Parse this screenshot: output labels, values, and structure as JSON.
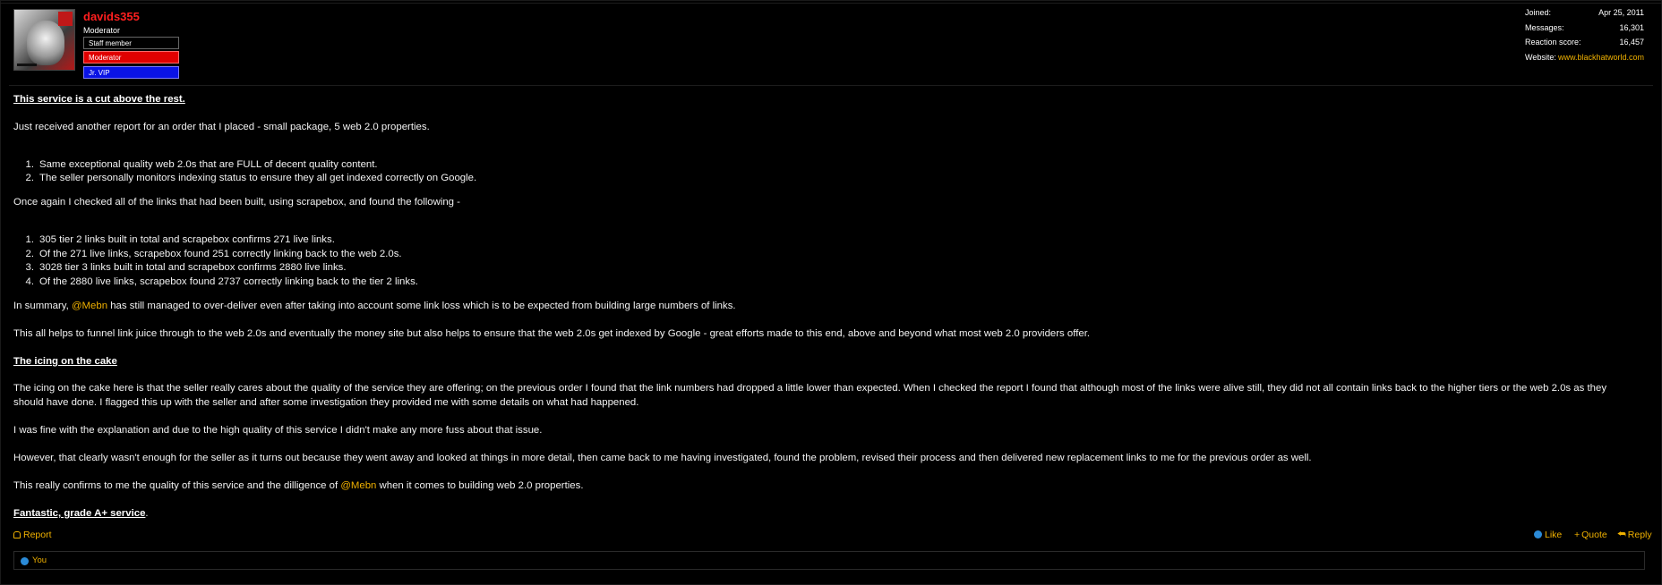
{
  "user": {
    "name": "davids355",
    "title": "Moderator",
    "banners": [
      "Staff member",
      "Moderator",
      "Jr. VIP"
    ]
  },
  "stats": [
    {
      "key": "Joined:",
      "value": "Apr 25, 2011"
    },
    {
      "key": "Messages:",
      "value": "16,301"
    },
    {
      "key": "Reaction score:",
      "value": "16,457"
    },
    {
      "key": "Website:",
      "value": "www.blackhatworld.com"
    }
  ],
  "post": {
    "heading1": "This service is a cut above the rest.",
    "p1": "Just received another report for an order that I placed - small package, 5 web 2.0 properties.",
    "list1": [
      "Same exceptional quality web 2.0s that are FULL of decent quality content.",
      "The seller personally monitors indexing status to ensure they all get indexed correctly on Google."
    ],
    "p2": "Once again I checked all of the links that had been built, using scrapebox, and found the following -",
    "list2": [
      "305 tier 2 links built in total and scrapebox confirms 271 live links.",
      "Of the 271 live links, scrapebox found 251 correctly linking back to the web 2.0s.",
      "3028 tier 3 links built in total and scrapebox confirms 2880 live links.",
      "Of the 2880 live links, scrapebox found 2737 correctly linking back to the tier 2 links."
    ],
    "p3_before": "In summary, ",
    "mention": "@Mebn",
    "p3_after": " has still managed to over-deliver even after taking into account some link loss which is to be expected from building large numbers of links.",
    "p4": "This all helps to funnel link juice through to the web 2.0s and eventually the money site but also helps to ensure that the web 2.0s get indexed by Google - great efforts made to this end, above and beyond what most web 2.0 providers offer.",
    "heading2": "The icing on the cake",
    "p5": "The icing on the cake here is that the seller really cares about the quality of the service they are offering; on the previous order I found that the link numbers had dropped a little lower than expected. When I checked the report I found that although most of the links were alive still, they did not all contain links back to the higher tiers or the web 2.0s as they should have done. I flagged this up with the seller and after some investigation they provided me with some details on what had happened.",
    "p6": "I was fine with the explanation and due to the high quality of this service I didn't make any more fuss about that issue.",
    "p7": "However, that clearly wasn't enough for the seller as it turns out because they went away and looked at things in more detail, then came back to me having investigated, found the problem, revised their process and then delivered new replacement links to me for the previous order as well.",
    "p8_before": "This really confirms to me the quality of this service and the dilligence of ",
    "p8_after": " when it comes to building web 2.0 properties.",
    "heading3": "Fantastic, grade A+ service",
    "heading3_tail": "."
  },
  "actions": {
    "report": "Report",
    "like": "Like",
    "quote": "Quote",
    "reply": "Reply"
  },
  "reactions": {
    "label": "You"
  },
  "colors": {
    "username": "#ff1f1f",
    "accent": "#f0b100",
    "moderator_banner": "#e00000",
    "vip_banner": "#0a13e6"
  }
}
